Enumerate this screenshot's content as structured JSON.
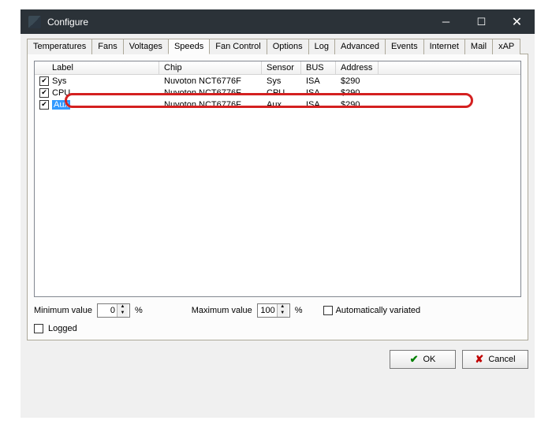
{
  "window": {
    "title": "Configure"
  },
  "tabs": {
    "items": [
      "Temperatures",
      "Fans",
      "Voltages",
      "Speeds",
      "Fan Control",
      "Options",
      "Log",
      "Advanced",
      "Events",
      "Internet",
      "Mail",
      "xAP"
    ],
    "active": "Speeds"
  },
  "table": {
    "columns": {
      "label": "Label",
      "chip": "Chip",
      "sensor": "Sensor",
      "bus": "BUS",
      "address": "Address"
    },
    "rows": [
      {
        "checked": true,
        "label": "Sys",
        "chip": "Nuvoton NCT6776F",
        "sensor": "Sys",
        "bus": "ISA",
        "address": "$290",
        "selected": false
      },
      {
        "checked": true,
        "label": "CPU",
        "chip": "Nuvoton NCT6776F",
        "sensor": "CPU",
        "bus": "ISA",
        "address": "$290",
        "selected": false
      },
      {
        "checked": true,
        "label": "Aux",
        "chip": "Nuvoton NCT6776F",
        "sensor": "Aux",
        "bus": "ISA",
        "address": "$290",
        "selected": true
      }
    ]
  },
  "controls": {
    "min_label": "Minimum value",
    "min_value": "0",
    "max_label": "Maximum value",
    "max_value": "100",
    "percent": "%",
    "auto_label": "Automatically variated",
    "auto_checked": false,
    "logged_label": "Logged",
    "logged_checked": false
  },
  "buttons": {
    "ok": "OK",
    "cancel": "Cancel"
  }
}
